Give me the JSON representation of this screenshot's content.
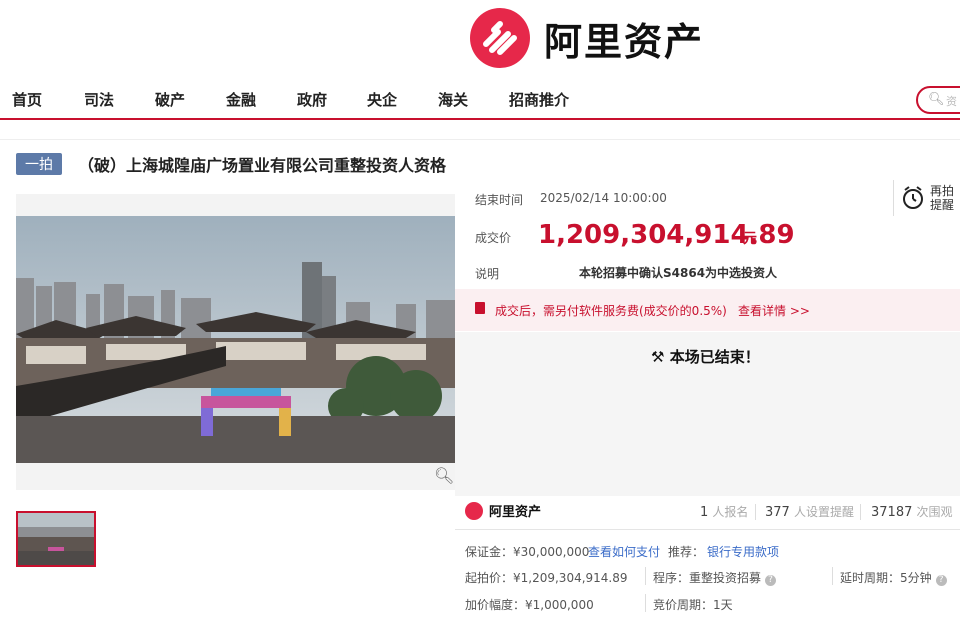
{
  "header": {
    "brand": "阿里资产"
  },
  "nav": {
    "items": [
      "首页",
      "司法",
      "破产",
      "金融",
      "政府",
      "央企",
      "海关",
      "招商推介"
    ],
    "search_placeholder": "资"
  },
  "auction": {
    "badge": "一拍",
    "title": "（破）上海城隍庙广场置业有限公司重整投资人资格",
    "end_time_label": "结束时间",
    "end_time": "2025/02/14 10:00:00",
    "remind_label": "再拍提醒",
    "price_label": "成交价",
    "price": "1,209,304,914.89",
    "price_unit": "元",
    "explain_label": "说明",
    "explain": "本轮招募中确认S4864为中选投资人",
    "notice": "成交后，需另付软件服务费(成交价的0.5%)",
    "notice_link": "查看详情 >>",
    "ended": "本场已结束！"
  },
  "stats": {
    "brand": "阿里资产",
    "signups": "1",
    "signups_label": "人报名",
    "reminders": "377",
    "reminders_label": "人设置提醒",
    "views": "37187",
    "views_label": "次围观"
  },
  "details": {
    "deposit": "保证金：¥30,000,000",
    "deposit_link": "查看如何支付",
    "recommend_label": "推荐：",
    "recommend_link": "银行专用款项",
    "start_price": "起拍价：¥1,209,304,914.89",
    "procedure": "程序：重整投资招募",
    "delay": "延时周期：5分钟",
    "increment": "加价幅度：¥1,000,000",
    "bid_cycle": "竞价周期：1天"
  },
  "colors": {
    "accent": "#c8102e",
    "brand": "#e6284a",
    "badge": "#5d7aa8",
    "link": "#3b6cc8"
  }
}
